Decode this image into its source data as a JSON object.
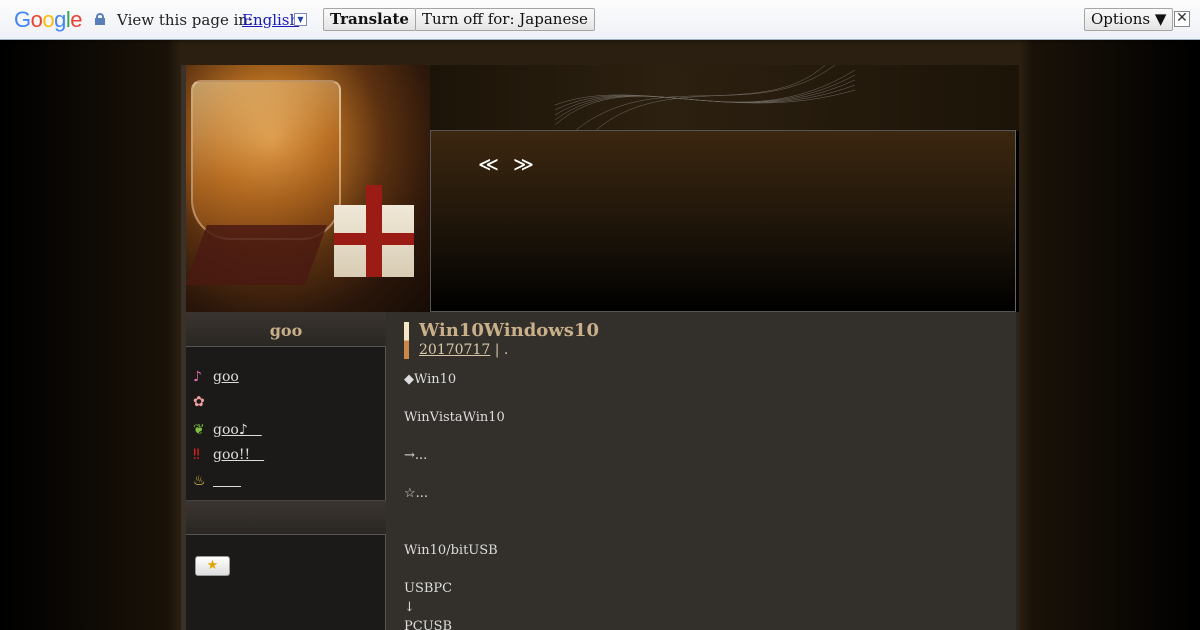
{
  "translate_bar": {
    "logo_text": "Google",
    "view_label": "View this page in:",
    "language": "English",
    "translate_label": "Translate",
    "turn_off_label": "Turn off for: Japanese",
    "options_label": "Options ▼",
    "close_glyph": "✕"
  },
  "header": {
    "nav_prev": "≪",
    "nav_next": "≫"
  },
  "sidebar": {
    "heading": "goo",
    "items": [
      {
        "icon": "♪",
        "label": "goo",
        "icon_color": "#e46ab0"
      },
      {
        "icon": "✿",
        "label": "",
        "icon_color": "#f0a0a0"
      },
      {
        "icon": "❦",
        "label": "goo♪　",
        "icon_color": "#7ec040"
      },
      {
        "icon": "‼",
        "label": "goo!!　",
        "icon_color": "#e02020"
      },
      {
        "icon": "💡",
        "label": "　　",
        "icon_color": "#f0d040"
      }
    ],
    "star_button": "★"
  },
  "post": {
    "title": "Win10Windows10",
    "date": "20170717",
    "date_suffix": " | .",
    "lines": [
      "◆Win10",
      "WinVistaWin10",
      "→...",
      "☆...",
      "Win10/bitUSB",
      "USBPC",
      "↓",
      "PCUSB"
    ]
  }
}
